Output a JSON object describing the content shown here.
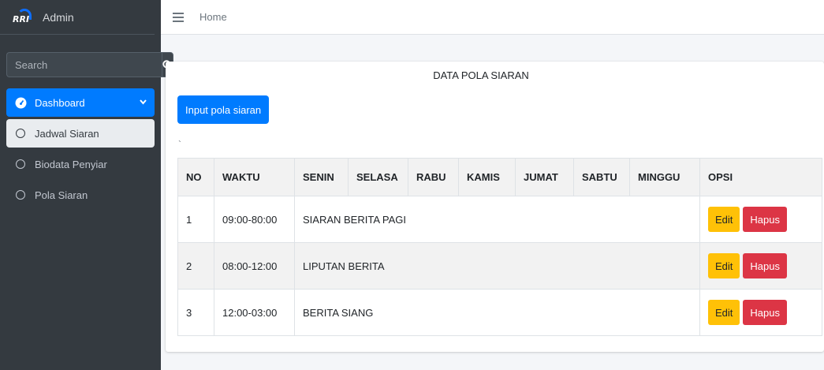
{
  "brand": {
    "logo_text": "RRI",
    "name": "Admin"
  },
  "search": {
    "placeholder": "Search"
  },
  "sidebar": {
    "items": [
      {
        "label": "Dashboard",
        "icon": "dashboard-icon"
      },
      {
        "label": "Jadwal Siaran",
        "icon": "circle-icon"
      },
      {
        "label": "Biodata Penyiar",
        "icon": "circle-icon"
      },
      {
        "label": "Pola Siaran",
        "icon": "circle-icon"
      }
    ]
  },
  "header": {
    "breadcrumb": "Home"
  },
  "card": {
    "title": "DATA POLA SIARAN",
    "input_button": "Input pola siaran",
    "tick": "`"
  },
  "table": {
    "columns": [
      "NO",
      "WAKTU",
      "SENIN",
      "SELASA",
      "RABU",
      "KAMIS",
      "JUMAT",
      "SABTU",
      "MINGGU",
      "OPSI"
    ],
    "rows": [
      {
        "no": "1",
        "waktu": "09:00-80:00",
        "program": "SIARAN BERITA PAGI"
      },
      {
        "no": "2",
        "waktu": "08:00-12:00",
        "program": "LIPUTAN BERITA"
      },
      {
        "no": "3",
        "waktu": "12:00-03:00",
        "program": "BERITA SIANG"
      }
    ],
    "edit_label": "Edit",
    "delete_label": "Hapus"
  },
  "colors": {
    "primary": "#007bff",
    "warning": "#ffc107",
    "danger": "#dc3545",
    "sidebar": "#343a40"
  }
}
